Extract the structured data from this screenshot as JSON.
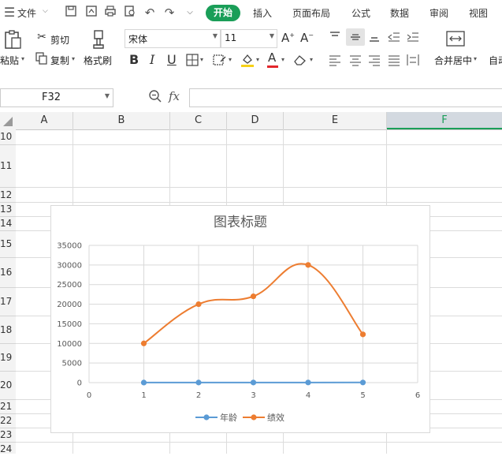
{
  "menu": {
    "file_label": "文件",
    "tabs": [
      "开始",
      "插入",
      "页面布局",
      "公式",
      "数据",
      "审阅",
      "视图"
    ]
  },
  "ribbon": {
    "paste": "粘贴",
    "cut": "剪切",
    "copy": "复制",
    "format_painter": "格式刷",
    "font_name": "宋体",
    "font_size": "11",
    "merge_center": "合并居中",
    "auto_wrap": "自动"
  },
  "formula_bar": {
    "name_box": "F32",
    "fx": "fx",
    "content": ""
  },
  "sheet": {
    "columns": [
      "A",
      "B",
      "C",
      "D",
      "E",
      "F"
    ],
    "selected_column": "F",
    "rows": [
      "10",
      "11",
      "12",
      "13",
      "14",
      "15",
      "16",
      "17",
      "18",
      "19",
      "20",
      "21",
      "22",
      "23",
      "24"
    ]
  },
  "chart_data": {
    "type": "scatter",
    "title": "图表标题",
    "xlim": [
      0,
      6
    ],
    "ylim": [
      0,
      35000
    ],
    "x_ticks": [
      "0",
      "1",
      "2",
      "3",
      "4",
      "5",
      "6"
    ],
    "y_ticks": [
      "0",
      "5000",
      "10000",
      "15000",
      "20000",
      "25000",
      "30000",
      "35000"
    ],
    "grid": true,
    "legend_position": "bottom",
    "series": [
      {
        "name": "年龄",
        "color": "#5b9bd5",
        "x": [
          1,
          2,
          3,
          4,
          5
        ],
        "values": [
          20,
          25,
          30,
          35,
          40
        ]
      },
      {
        "name": "绩效",
        "color": "#ed7d31",
        "x": [
          1,
          2,
          3,
          4,
          5
        ],
        "values": [
          10000,
          20000,
          22000,
          30000,
          12300
        ]
      }
    ]
  }
}
